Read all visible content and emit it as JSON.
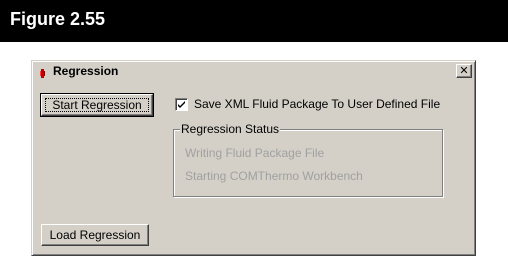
{
  "figure": {
    "label": "Figure 2.55"
  },
  "dialog": {
    "title": "Regression",
    "close_glyph": "✕",
    "buttons": {
      "start_regression": "Start Regression",
      "load_regression": "Load Regression"
    },
    "checkbox": {
      "label": "Save XML Fluid Package To User Defined File",
      "checked": true
    },
    "status_group": {
      "title": "Regression Status",
      "lines": [
        "Writing Fluid Package File",
        "Starting COMThermo Workbench"
      ]
    }
  },
  "icons": {
    "app": "app-icon",
    "close": "close-icon",
    "check": "check-icon"
  },
  "colors": {
    "banner_bg": "#000000",
    "dialog_bg": "#d4d0c8",
    "disabled_text": "#a0a0a0"
  }
}
